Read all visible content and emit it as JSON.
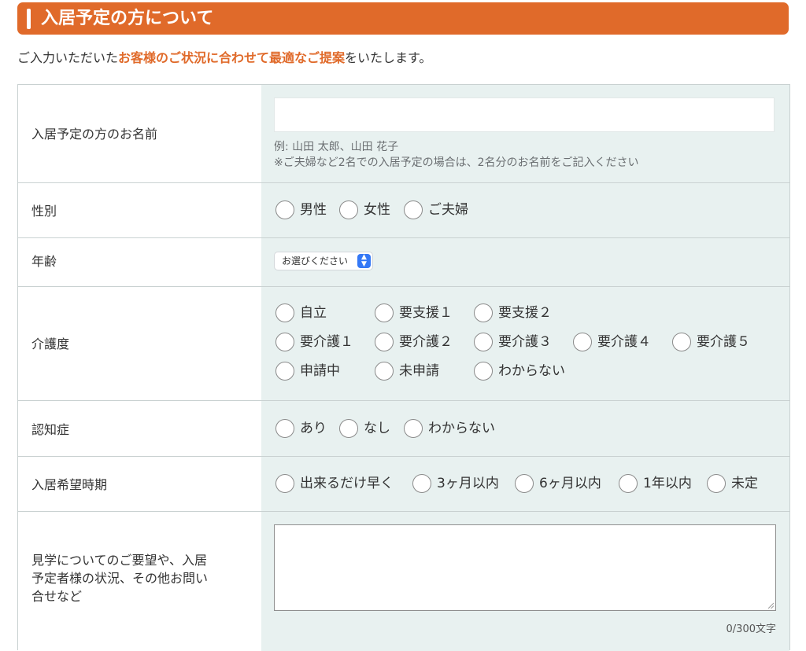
{
  "header": {
    "title": "入居予定の方について"
  },
  "intro": {
    "before": "ご入力いただいた",
    "highlight": "お客様のご状況に合わせて最適なご提案",
    "after": "をいたします。"
  },
  "colors": {
    "accent": "#e06a2a",
    "field_bg": "#e8f1f0",
    "border": "#c9d1d1"
  },
  "form": {
    "name": {
      "label": "入居予定の方のお名前",
      "value": "",
      "hint1": "例: 山田 太郎、山田 花子",
      "hint2": "※ご夫婦など2名での入居予定の場合は、2名分のお名前をご記入ください"
    },
    "gender": {
      "label": "性別",
      "options": [
        "男性",
        "女性",
        "ご夫婦"
      ]
    },
    "age": {
      "label": "年齢",
      "selected": "お選びください",
      "icon": "up-down-chevron-icon"
    },
    "care": {
      "label": "介護度",
      "options": [
        "自立",
        "要支援１",
        "要支援２",
        "要介護１",
        "要介護２",
        "要介護３",
        "要介護４",
        "要介護５",
        "申請中",
        "未申請",
        "わからない"
      ]
    },
    "dementia": {
      "label": "認知症",
      "options": [
        "あり",
        "なし",
        "わからない"
      ]
    },
    "timing": {
      "label": "入居希望時期",
      "options": [
        "出来るだけ早く",
        "3ヶ月以内",
        "6ヶ月以内",
        "1年以内",
        "未定"
      ]
    },
    "requests": {
      "label_lines": [
        "見学についてのご要望や、入居",
        "予定者様の状況、その他お問い",
        "合せなど"
      ],
      "value": "",
      "counter": "0/300文字"
    }
  }
}
